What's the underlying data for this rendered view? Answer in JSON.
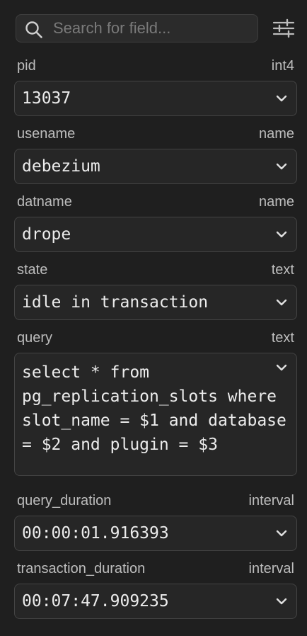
{
  "search": {
    "placeholder": "Search for field..."
  },
  "fields": [
    {
      "name": "pid",
      "type": "int4",
      "value": "13037"
    },
    {
      "name": "usename",
      "type": "name",
      "value": "debezium"
    },
    {
      "name": "datname",
      "type": "name",
      "value": "drope"
    },
    {
      "name": "state",
      "type": "text",
      "value": "idle in transaction"
    },
    {
      "name": "query",
      "type": "text",
      "value": "select * from pg_replication_slots where slot_name = $1 and database = $2 and plugin = $3"
    },
    {
      "name": "query_duration",
      "type": "interval",
      "value": "00:00:01.916393"
    },
    {
      "name": "transaction_duration",
      "type": "interval",
      "value": "00:07:47.909235"
    }
  ],
  "icons": {
    "search": "search-icon",
    "filter": "sliders-icon",
    "expand": "chevron-down-icon"
  },
  "colors": {
    "background": "#1f1f1f",
    "field_box": "#262626",
    "border": "#444444",
    "label": "#bdbdbd",
    "value": "#ececec"
  }
}
